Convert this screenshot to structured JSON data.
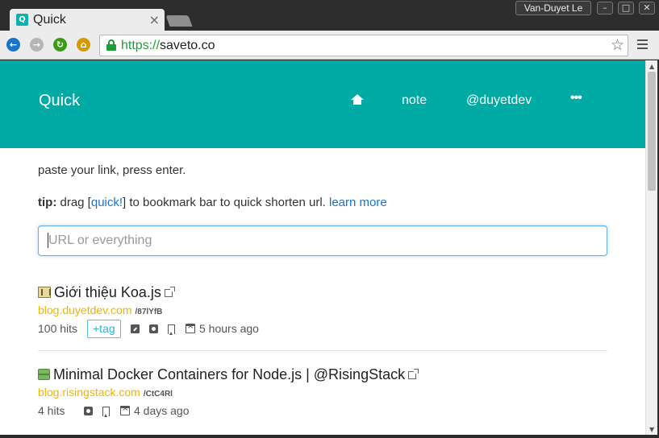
{
  "window": {
    "tab_title": "Quick",
    "tab_favicon_letter": "Q",
    "profile_name": "Van-Duyet Le",
    "minimize_glyph": "–",
    "maximize_glyph": "□",
    "close_glyph": "✕"
  },
  "browser": {
    "url_scheme": "https://",
    "url_host": "saveto.co",
    "nav_icons": [
      "back-icon",
      "forward-icon",
      "reload-icon",
      "home-icon"
    ],
    "colors": {
      "back": "#1a73c9",
      "forward": "#b5b5b5",
      "reload": "#3b9a17",
      "home": "#d59a00"
    }
  },
  "site": {
    "brand": "Quick",
    "nav": {
      "home_icon": "home-icon",
      "note": "note",
      "user": "@duyetdev",
      "more": "•••"
    },
    "accent_color": "#00aaa5"
  },
  "intro": {
    "instruction": "paste your link, press enter.",
    "tip_label": "tip:",
    "tip_part1": " drag [",
    "tip_quick": "quick!",
    "tip_part2": "] to bookmark bar to quick shorten url. ",
    "tip_learn_more": "learn more"
  },
  "search": {
    "placeholder": "URL or everything"
  },
  "links": [
    {
      "emoji": "koa-emoji-icon",
      "title": "Giới thiệu Koa.js",
      "host": "blog.duyetdev.com",
      "short": "/87lYfB",
      "hits": "100 hits",
      "tag_label": "+tag",
      "time": "5 hours ago"
    },
    {
      "emoji": "package-emoji-icon",
      "title": "Minimal Docker Containers for Node.js | @RisingStack",
      "host": "blog.risingstack.com",
      "short": "/CtC4Rl",
      "hits": "4 hits",
      "time": "4 days ago"
    }
  ]
}
